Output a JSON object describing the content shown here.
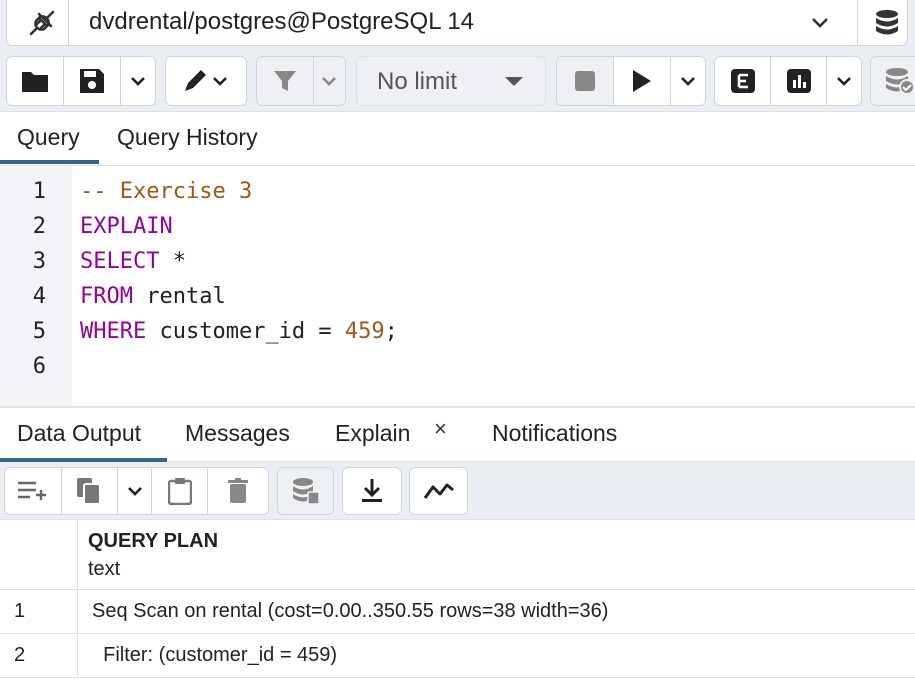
{
  "connection": {
    "label": "dvdrental/postgres@PostgreSQL 14",
    "icons": [
      "disconnect-plug-icon",
      "chevron-down-icon",
      "database-stack-icon"
    ]
  },
  "toolbar": {
    "buttons": [
      {
        "name": "open-file-button",
        "icon": "folder-icon"
      },
      {
        "name": "save-file-button",
        "icon": "floppy-disk-icon"
      },
      {
        "name": "save-options-dropdown",
        "icon": "chevron-down-icon"
      },
      {
        "name": "edit-button",
        "icon": "pencil-icon"
      },
      {
        "name": "filter-button",
        "icon": "funnel-icon"
      },
      {
        "name": "stop-button",
        "icon": "stop-square-icon"
      },
      {
        "name": "execute-button",
        "icon": "play-icon"
      },
      {
        "name": "explain-button",
        "icon": "letter-e-icon"
      },
      {
        "name": "explain-analyze-button",
        "icon": "bar-chart-icon"
      },
      {
        "name": "commit-button",
        "icon": "database-check-icon"
      }
    ],
    "limit_select": {
      "value": "No limit"
    }
  },
  "query_tabs": {
    "items": [
      {
        "label": "Query",
        "active": true
      },
      {
        "label": "Query History",
        "active": false
      }
    ]
  },
  "editor": {
    "lines": [
      {
        "number": "1",
        "tokens": [
          {
            "text": "-- Exercise 3",
            "kind": "comment"
          }
        ]
      },
      {
        "number": "2",
        "tokens": [
          {
            "text": "EXPLAIN",
            "kind": "kw"
          }
        ]
      },
      {
        "number": "3",
        "tokens": [
          {
            "text": "SELECT",
            "kind": "kw"
          },
          {
            "text": " *",
            "kind": "plain"
          }
        ]
      },
      {
        "number": "4",
        "tokens": [
          {
            "text": "FROM",
            "kind": "kw"
          },
          {
            "text": " rental",
            "kind": "plain"
          }
        ]
      },
      {
        "number": "5",
        "tokens": [
          {
            "text": "WHERE",
            "kind": "kw"
          },
          {
            "text": " customer_id = ",
            "kind": "plain"
          },
          {
            "text": "459",
            "kind": "num"
          },
          {
            "text": ";",
            "kind": "plain"
          }
        ]
      },
      {
        "number": "6",
        "tokens": []
      }
    ],
    "colors": {
      "keyword": "#990099",
      "comment": "#9c5a14",
      "number": "#a05a1e"
    }
  },
  "result_tabs": {
    "items": [
      {
        "label": "Data Output",
        "active": true
      },
      {
        "label": "Messages",
        "active": false
      },
      {
        "label": "Explain",
        "active": false,
        "closable": true
      },
      {
        "label": "Notifications",
        "active": false
      }
    ],
    "close_glyph": "×"
  },
  "result_toolbar": {
    "buttons": [
      {
        "name": "add-row-button",
        "icon": "add-row-icon"
      },
      {
        "name": "copy-button",
        "icon": "copy-icon"
      },
      {
        "name": "copy-options-dropdown",
        "icon": "chevron-down-icon"
      },
      {
        "name": "paste-button",
        "icon": "clipboard-icon"
      },
      {
        "name": "delete-button",
        "icon": "trash-icon"
      },
      {
        "name": "save-data-button",
        "icon": "database-save-icon"
      },
      {
        "name": "download-button",
        "icon": "download-icon"
      },
      {
        "name": "graph-visualiser-button",
        "icon": "line-graph-icon"
      }
    ]
  },
  "grid": {
    "column": {
      "name": "QUERY PLAN",
      "type": "text"
    },
    "rows": [
      {
        "num": "1",
        "value": "Seq Scan on rental  (cost=0.00..350.55 rows=38 width=36)"
      },
      {
        "num": "2",
        "value": "  Filter: (customer_id = 459)"
      }
    ]
  },
  "colors": {
    "accent": "#326690",
    "toolbar_bg": "#ebeef3",
    "gutter_bg": "#f3f4f7"
  }
}
